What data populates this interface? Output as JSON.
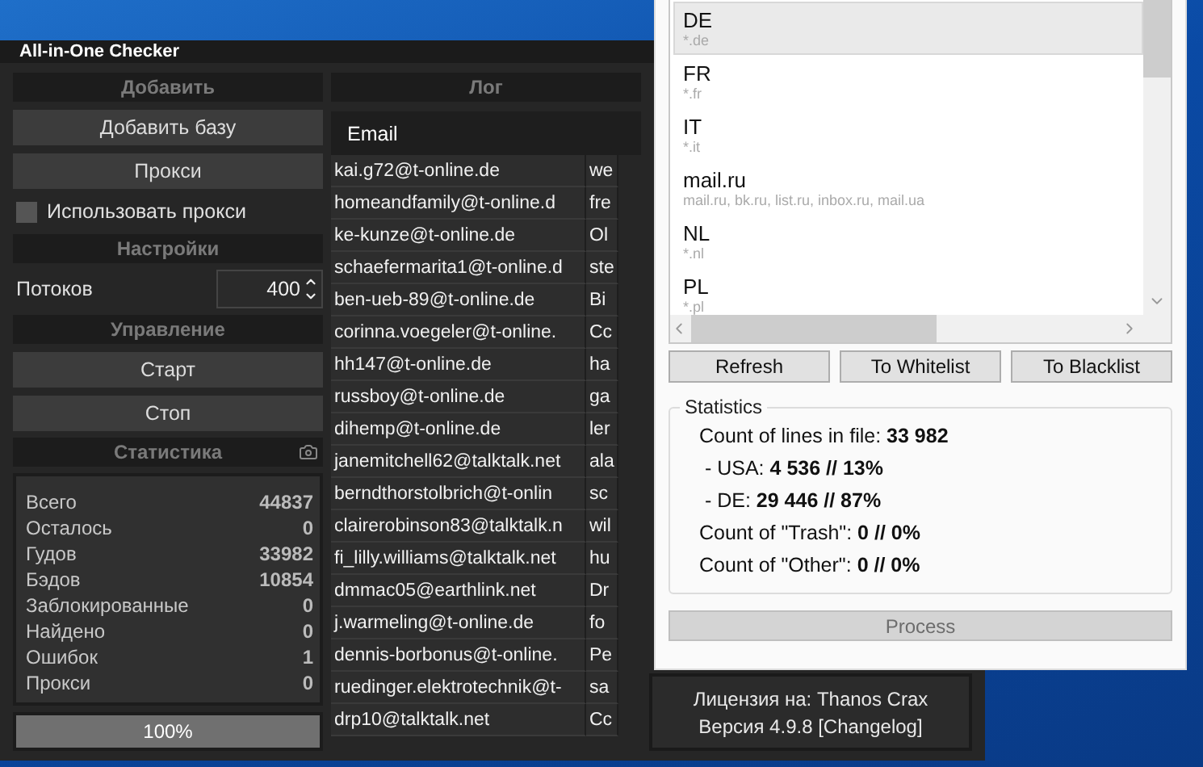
{
  "window": {
    "title": "All-in-One Checker"
  },
  "add_section": {
    "header": "Добавить",
    "buttons": [
      "Добавить базу",
      "Прокси"
    ],
    "use_proxy": {
      "label": "Использовать прокси",
      "checked": false
    }
  },
  "settings_section": {
    "header": "Настройки",
    "threads": {
      "label": "Потоков",
      "value": "400"
    }
  },
  "control_section": {
    "header": "Управление",
    "buttons": [
      "Старт",
      "Стоп"
    ]
  },
  "statistics_section": {
    "header": "Статистика",
    "rows": [
      {
        "label": "Всего",
        "value": "44837"
      },
      {
        "label": "Осталось",
        "value": "0"
      },
      {
        "label": "Гудов",
        "value": "33982"
      },
      {
        "label": "Бэдов",
        "value": "10854"
      },
      {
        "label": "Заблокированные",
        "value": "0"
      },
      {
        "label": "Найдено",
        "value": "0"
      },
      {
        "label": "Ошибок",
        "value": "1"
      },
      {
        "label": "Прокси",
        "value": "0"
      }
    ],
    "progress": {
      "level": 1,
      "text": "100%"
    }
  },
  "log": {
    "header": "Лог",
    "columns": [
      "Email"
    ],
    "rows": [
      [
        "kai.g72@t-online.de",
        "we"
      ],
      [
        "homeandfamily@t-online.d",
        "fre"
      ],
      [
        "ke-kunze@t-online.de",
        "Ol"
      ],
      [
        "schaefermarita1@t-online.d",
        "ste"
      ],
      [
        "ben-ueb-89@t-online.de",
        "Bi"
      ],
      [
        "corinna.voegeler@t-online.",
        "Cc"
      ],
      [
        "hh147@t-online.de",
        "ha"
      ],
      [
        "russboy@t-online.de",
        "ga"
      ],
      [
        "dihemp@t-online.de",
        "ler"
      ],
      [
        "janemitchell62@talktalk.net",
        "ala"
      ],
      [
        "berndthorstolbrich@t-onlin",
        "sc"
      ],
      [
        "clairerobinson83@talktalk.n",
        "wil"
      ],
      [
        "fi_lilly.williams@talktalk.net",
        "hu"
      ],
      [
        "dmmac05@earthlink.net",
        "Dr"
      ],
      [
        "j.warmeling@t-online.de",
        "fo"
      ],
      [
        "dennis-borbonus@t-online.",
        "Pe"
      ],
      [
        "ruedinger.elektrotechnik@t-",
        "sa"
      ],
      [
        "drp10@talktalk.net",
        "Cc"
      ]
    ]
  },
  "license": {
    "lines": [
      "Лицензия на: Thanos Crax",
      "Версия 4.9.8 [Changelog]"
    ]
  },
  "dialog": {
    "domains": [
      {
        "name": "DE",
        "pattern": "*.de",
        "selected": true
      },
      {
        "name": "FR",
        "pattern": "*.fr",
        "selected": false
      },
      {
        "name": "IT",
        "pattern": "*.it",
        "selected": false
      },
      {
        "name": "mail.ru",
        "pattern": "mail.ru, bk.ru, list.ru, inbox.ru, mail.ua",
        "selected": false
      },
      {
        "name": "NL",
        "pattern": "*.nl",
        "selected": false
      },
      {
        "name": "PL",
        "pattern": "*.pl",
        "selected": false
      }
    ],
    "buttons": [
      "Refresh",
      "To Whitelist",
      "To Blacklist"
    ],
    "statistics": {
      "title": "Statistics",
      "lines": [
        "Count of lines in file: **33 982**",
        " - USA: **4 536 // 13%**",
        " - DE: **29 446 // 87%**",
        "Count of \"Trash\": **0 // 0%**",
        "Count of \"Other\": **0 // 0%**"
      ]
    },
    "process_button": {
      "label": "Process",
      "disabled": true
    }
  }
}
